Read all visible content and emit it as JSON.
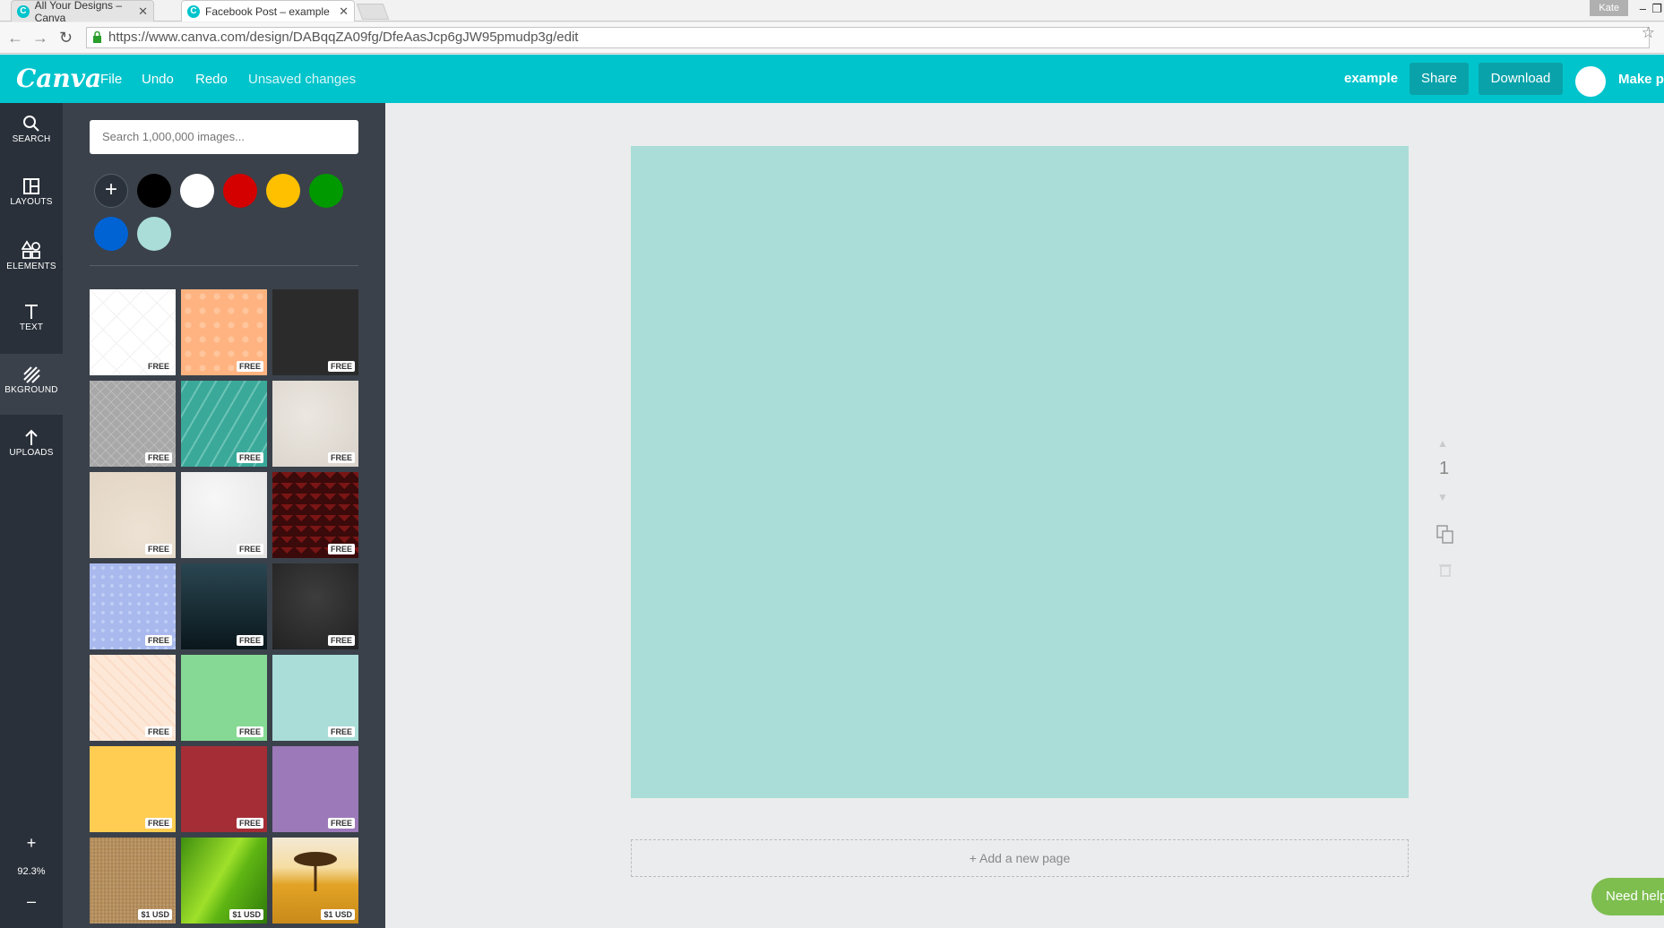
{
  "browser": {
    "tabs": [
      {
        "title": "All Your Designs – Canva",
        "active": false
      },
      {
        "title": "Facebook Post – example",
        "active": true
      }
    ],
    "user": "Kate",
    "url": "https://www.canva.com/design/DABqqZA09fg/DfeAasJcp6gJW95pmudp3g/edit"
  },
  "header": {
    "logo": "Canva",
    "menu": [
      "File",
      "Undo",
      "Redo"
    ],
    "status": "Unsaved changes",
    "design_name": "example",
    "share_label": "Share",
    "download_label": "Download",
    "make_public_label": "Make pu"
  },
  "rail": {
    "items": [
      {
        "label": "SEARCH",
        "icon": "search-icon"
      },
      {
        "label": "LAYOUTS",
        "icon": "layouts-icon"
      },
      {
        "label": "ELEMENTS",
        "icon": "elements-icon"
      },
      {
        "label": "TEXT",
        "icon": "text-icon"
      },
      {
        "label": "BKGROUND",
        "icon": "background-icon",
        "active": true
      },
      {
        "label": "UPLOADS",
        "icon": "upload-icon"
      }
    ],
    "zoom_in": "+",
    "zoom_out": "–",
    "zoom_level": "92.3%"
  },
  "panel": {
    "search_placeholder": "Search 1,000,000 images...",
    "add_color": "+",
    "colors": [
      "#000000",
      "#ffffff",
      "#d40000",
      "#ffc000",
      "#009900",
      "#0063d4",
      "#aaddd8"
    ],
    "backgrounds": [
      {
        "name": "white-diamond",
        "tag": "FREE"
      },
      {
        "name": "peach-pattern",
        "tag": "FREE"
      },
      {
        "name": "charcoal-texture",
        "tag": "FREE"
      },
      {
        "name": "grey-lattice",
        "tag": "FREE"
      },
      {
        "name": "teal-diagonal-stripes",
        "tag": "FREE"
      },
      {
        "name": "paper-texture",
        "tag": "FREE"
      },
      {
        "name": "beige-watercolor",
        "tag": "FREE"
      },
      {
        "name": "white-marble",
        "tag": "FREE"
      },
      {
        "name": "red-chevron",
        "tag": "FREE"
      },
      {
        "name": "lavender-dots",
        "tag": "FREE"
      },
      {
        "name": "dark-teal-gradient",
        "tag": "FREE"
      },
      {
        "name": "dark-grey-gradient",
        "tag": "FREE"
      },
      {
        "name": "cream-chevron",
        "tag": "FREE"
      },
      {
        "name": "green-solid",
        "tag": "FREE"
      },
      {
        "name": "mint-solid",
        "tag": "FREE"
      },
      {
        "name": "yellow-solid",
        "tag": "FREE"
      },
      {
        "name": "crimson-solid",
        "tag": "FREE"
      },
      {
        "name": "purple-solid",
        "tag": "FREE"
      },
      {
        "name": "burlap-photo",
        "tag": "$1 USD"
      },
      {
        "name": "green-leaf-photo",
        "tag": "$1 USD"
      },
      {
        "name": "tree-field-photo",
        "tag": "$1 USD"
      }
    ]
  },
  "canvas": {
    "background_color": "#aaddd8",
    "page_number": "1",
    "add_page_label": "+ Add a new page"
  },
  "help": {
    "label": "Need help"
  }
}
